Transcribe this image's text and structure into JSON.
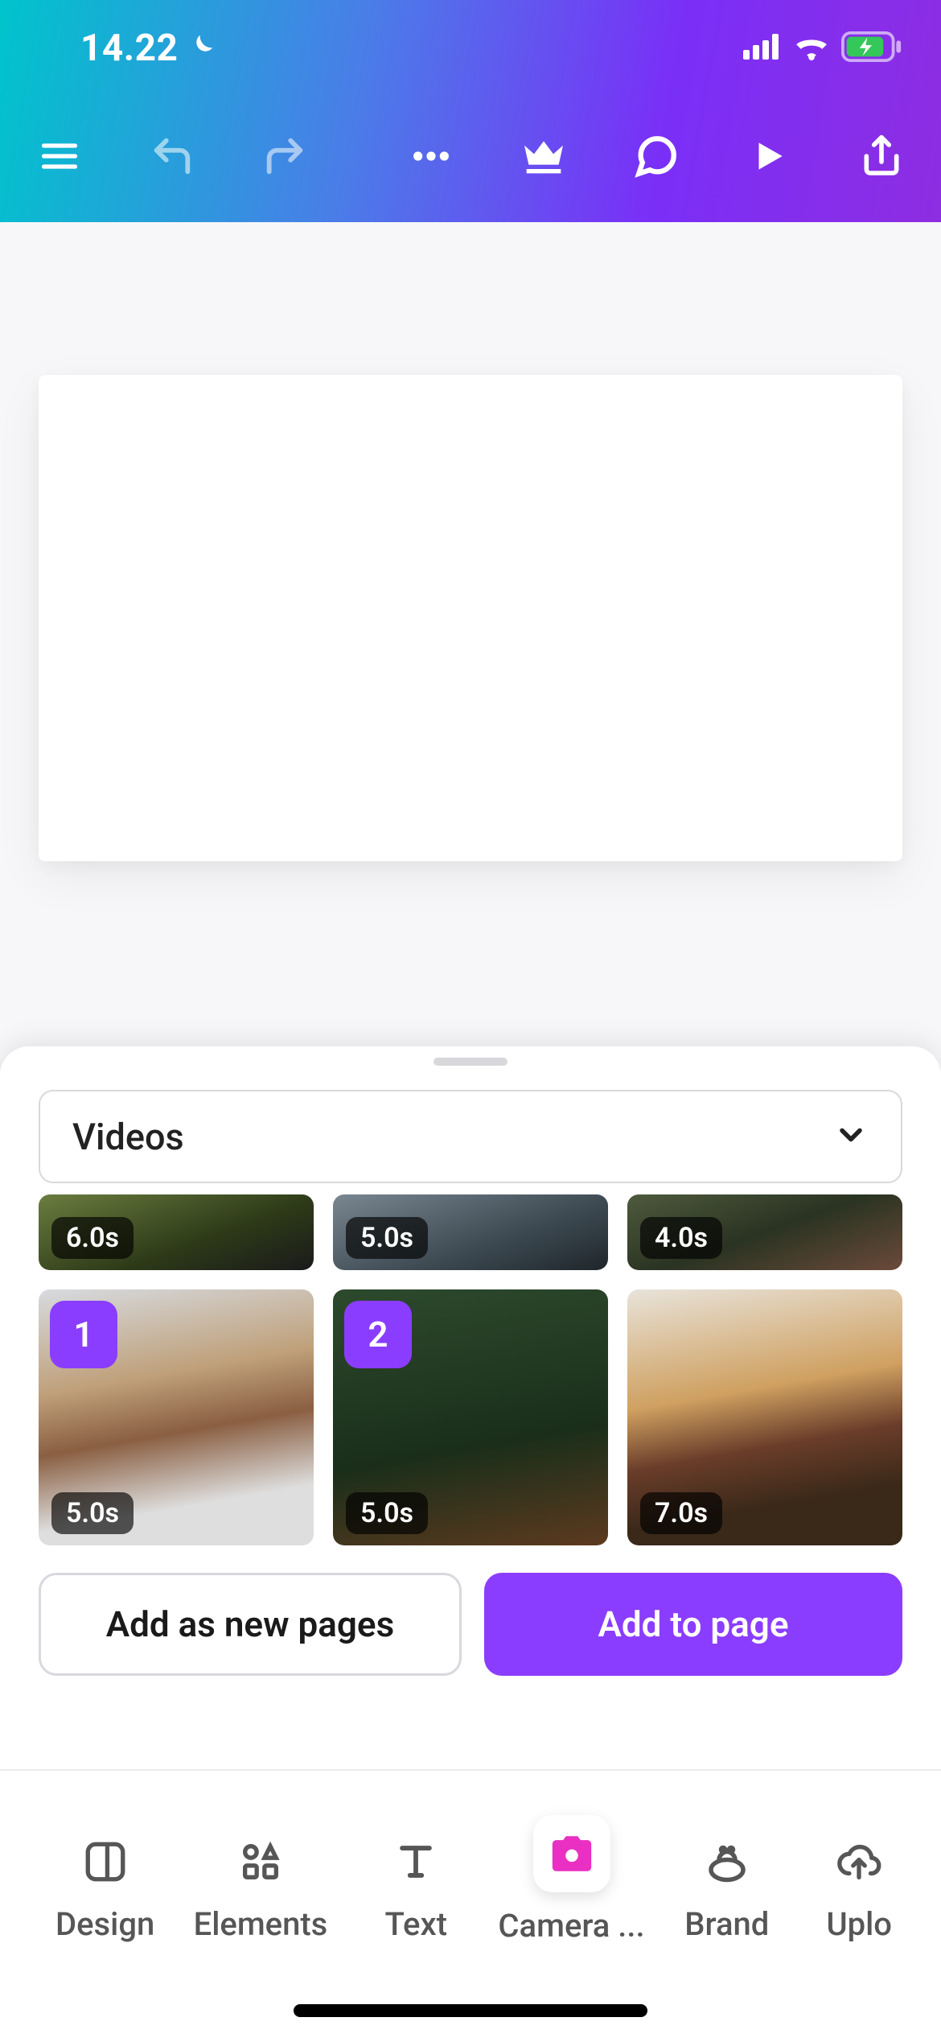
{
  "status": {
    "time": "14.22"
  },
  "sheet": {
    "dropdown_label": "Videos",
    "videos_row1": [
      {
        "duration": "6.0s"
      },
      {
        "duration": "5.0s"
      },
      {
        "duration": "4.0s"
      }
    ],
    "videos_row2": [
      {
        "duration": "5.0s",
        "selected": "1"
      },
      {
        "duration": "5.0s",
        "selected": "2"
      },
      {
        "duration": "7.0s"
      }
    ],
    "add_new_pages_label": "Add as new pages",
    "add_to_page_label": "Add to page"
  },
  "nav": {
    "items": [
      {
        "label": "Design"
      },
      {
        "label": "Elements"
      },
      {
        "label": "Text"
      },
      {
        "label": "Camera ..."
      },
      {
        "label": "Brand"
      },
      {
        "label": "Uplo"
      }
    ]
  }
}
